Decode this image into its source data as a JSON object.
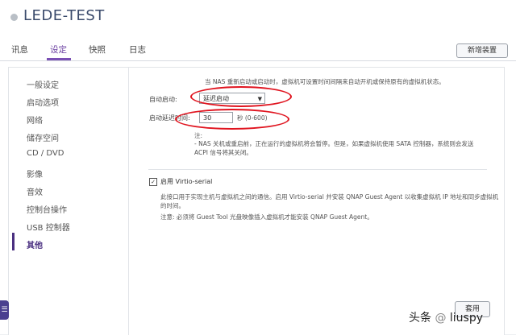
{
  "window": {
    "vm_name": "LEDE-TEST"
  },
  "tabs": [
    {
      "label": "讯息"
    },
    {
      "label": "设定"
    },
    {
      "label": "快照"
    },
    {
      "label": "日志"
    }
  ],
  "toolbar": {
    "new_device_label": "新增装置"
  },
  "sidebar": {
    "items": [
      {
        "label": "一般设定"
      },
      {
        "label": "启动选项"
      },
      {
        "label": "网络"
      },
      {
        "label": "储存空间"
      },
      {
        "label": "CD / DVD"
      },
      {
        "label": "影像"
      },
      {
        "label": "音效"
      },
      {
        "label": "控制台操作"
      },
      {
        "label": "USB 控制器"
      },
      {
        "label": "其他"
      }
    ],
    "active_index": 9
  },
  "main": {
    "top_note": "当 NAS 重新启动或启动时，虚拟机可设置时间间隔来自动开机或保持原有的虚拟机状态。",
    "autostart_label": "自动启动:",
    "autostart_value": "延迟启动",
    "delay_label": "启动延迟时间:",
    "delay_value": "30",
    "delay_unit": "秒 (0-600)",
    "note_title": "注:",
    "note_text": "- NAS 关机或重启前，正在运行的虚拟机将会暂停。但是，如果虚拟机使用 SATA 控制器，系统则会发送 ACPI 信号将其关闭。",
    "virtio_label": "启用 Virtio-serial",
    "virtio_checked": true,
    "virtio_desc": "此接口用于实现主机与虚拟机之间的通信。启用 Virtio-serial 并安装 QNAP Guest Agent 以收集虚拟机 IP 地址和同步虚拟机的时间。",
    "virtio_note": "注意: 必须将 Guest Tool 光盘映像插入虚拟机才能安装 QNAP Guest Agent。",
    "apply_label": "套用"
  },
  "watermark": {
    "prefix": "头条",
    "separator": "@",
    "handle": "liuspy"
  },
  "colors": {
    "accent": "#7a4fb4",
    "annotation": "#e0141f"
  }
}
